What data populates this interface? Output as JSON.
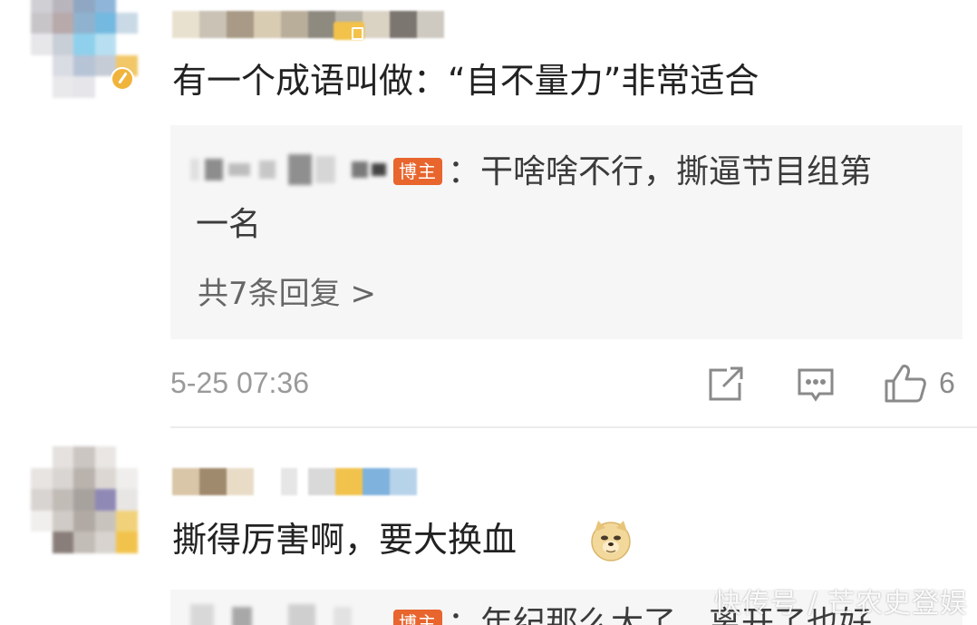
{
  "comments": [
    {
      "text": "有一个成语叫做：“自不量力”非常适合",
      "reply": {
        "tag": "博主",
        "line1": "：干啥啥不行，撕逼节目组第",
        "line2": "一名",
        "count_label": "共7条回复 >"
      },
      "time": "5-25 07:36",
      "likes": "6",
      "icons": [
        "share-icon",
        "comment-icon",
        "like-icon"
      ]
    },
    {
      "text": "撕得厉害啊，要大换血",
      "emoji": "doge-emoji",
      "reply": {
        "tag": "博主",
        "line1": "：年纪那么大了，离开了也好"
      }
    }
  ],
  "watermark": "快传号 / 芒农史登娱",
  "colors": {
    "blogger_tag": "#e8652e",
    "reply_bg": "#f6f6f6",
    "meta_gray": "#9a9a9a",
    "level_badge": "#f3c24a"
  }
}
